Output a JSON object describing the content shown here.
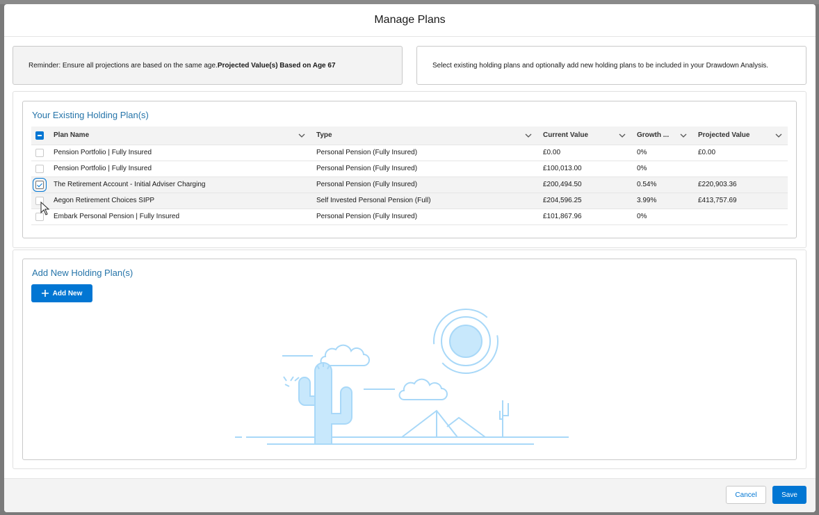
{
  "modal": {
    "title": "Manage Plans"
  },
  "reminder": {
    "text": "Reminder: Ensure all projections are based on the same age.",
    "bold": "Projected Value(s) Based on Age 67"
  },
  "select_info": "Select existing holding plans and optionally add new holding plans to be included in your Drawdown Analysis.",
  "existing": {
    "title": "Your Existing Holding Plan(s)",
    "columns": [
      "Plan Name",
      "Type",
      "Current Value",
      "Growth ...",
      "Projected Value"
    ],
    "rows": [
      {
        "name": "Pension Portfolio | Fully Insured",
        "type": "Personal Pension (Fully Insured)",
        "current": "£0.00",
        "growth": "0%",
        "projected": "£0.00",
        "checked": false
      },
      {
        "name": "Pension Portfolio | Fully Insured",
        "type": "Personal Pension (Fully Insured)",
        "current": "£100,013.00",
        "growth": "0%",
        "projected": "",
        "checked": false
      },
      {
        "name": "The Retirement Account - Initial Adviser Charging",
        "type": "Personal Pension (Fully Insured)",
        "current": "£200,494.50",
        "growth": "0.54%",
        "projected": "£220,903.36",
        "checked": true
      },
      {
        "name": "Aegon Retirement Choices SIPP",
        "type": "Self Invested Personal Pension (Full)",
        "current": "£204,596.25",
        "growth": "3.99%",
        "projected": "£413,757.69",
        "checked": false
      },
      {
        "name": "Embark Personal Pension | Fully Insured",
        "type": "Personal Pension (Fully Insured)",
        "current": "£101,867.96",
        "growth": "0%",
        "projected": "",
        "checked": false
      }
    ]
  },
  "add_new": {
    "title": "Add New Holding Plan(s)",
    "button": "Add New"
  },
  "footer": {
    "cancel": "Cancel",
    "save": "Save"
  },
  "colors": {
    "brand": "#0176d3",
    "title_blue": "#2574a9",
    "illustration": "#bfe3fb"
  }
}
